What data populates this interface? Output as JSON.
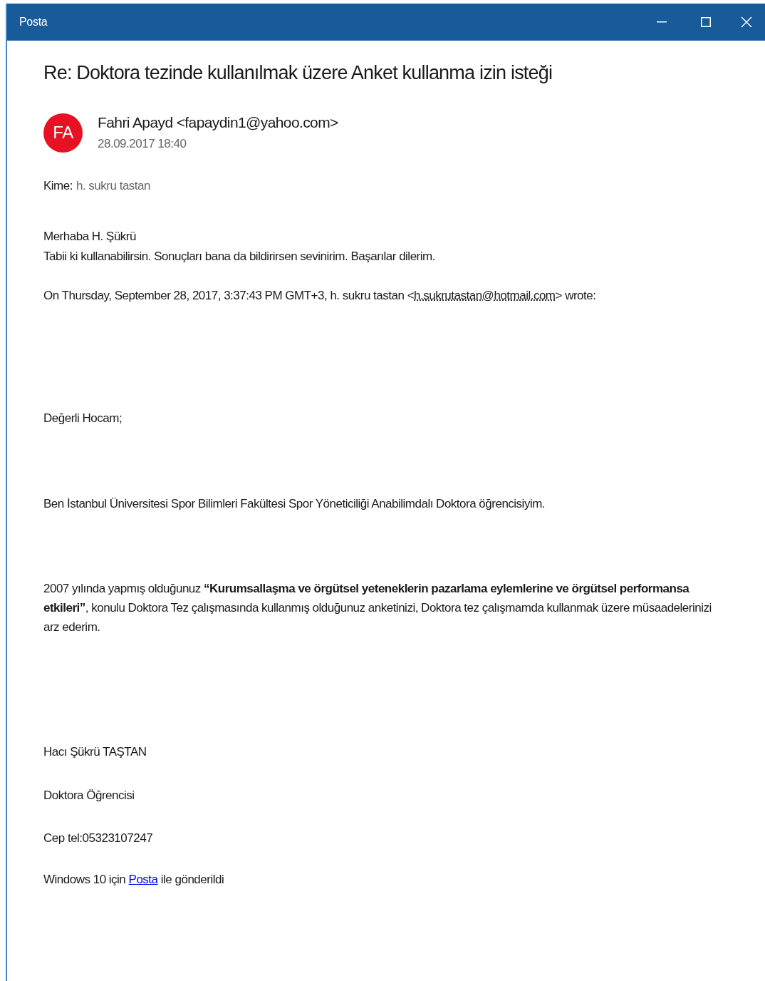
{
  "window": {
    "title": "Posta"
  },
  "message": {
    "subject": "Re: Doktora tezinde kullanılmak üzere Anket kullanma izin isteği",
    "sender": {
      "initials": "FA",
      "name": "Fahri Apayd <fapaydin1@yahoo.com>",
      "date": "28.09.2017 18:40"
    },
    "to": {
      "label": "Kime:",
      "value": "h. sukru tastan"
    },
    "body": [
      {
        "kind": "text",
        "text": "Merhaba H. Şükrü"
      },
      {
        "kind": "text",
        "text": "Tabii ki kullanabilirsin. Sonuçları bana da bildirirsen sevinirim. Başarılar dilerim."
      },
      {
        "kind": "link_line",
        "before": "On Thursday, September 28, 2017, 3:37:43 PM GMT+3, h. sukru tastan <",
        "link": "h.sukrutastan@hotmail.com",
        "after": "> wrote:",
        "dotted": true
      },
      {
        "kind": "text",
        "text": "Değerli Hocam;"
      },
      {
        "kind": "text",
        "text": "Ben İstanbul Üniversitesi Spor Bilimleri Fakültesi Spor Yöneticiliği Anabilimdalı Doktora öğrencisiyim."
      },
      {
        "kind": "text",
        "text": "2007 yılında yapmış olduğunuz **“Kurumsallaşma ve örgütsel yeteneklerin pazarlama eylemlerine ve örgütsel performansa etkileri”**, konulu Doktora Tez çalışmasında kullanmış olduğunuz anketinizi,  Doktora tez çalışmamda kullanmak üzere müsaadelerinizi arz ederim."
      },
      {
        "kind": "text",
        "text": "Hacı Şükrü TAŞTAN"
      },
      {
        "kind": "text",
        "text": "Doktora Öğrencisi"
      },
      {
        "kind": "text",
        "text": "Cep tel:05323107247"
      },
      {
        "kind": "link_line",
        "before": "Windows 10 için ",
        "link": "Posta",
        "after": " ile gönderildi",
        "dotted": false
      }
    ]
  }
}
